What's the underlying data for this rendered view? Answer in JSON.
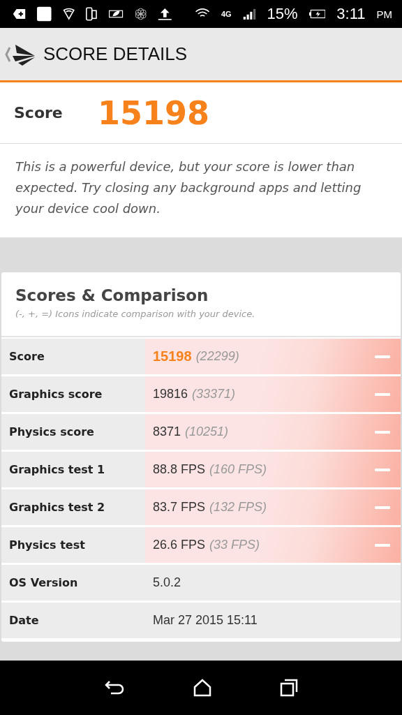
{
  "status_bar": {
    "battery_percent": "15%",
    "time": "3:11",
    "time_suffix": "PM",
    "network_label": "4G"
  },
  "header": {
    "title": "SCORE DETAILS"
  },
  "score": {
    "label": "Score",
    "value": "15198"
  },
  "message": "This is a powerful device, but your score is lower than expected. Try closing any background apps and letting your device cool down.",
  "comparison": {
    "title": "Scores & Comparison",
    "subtitle": "(-, +, =) Icons indicate comparison with your device.",
    "rows": [
      {
        "kind": "score",
        "label": "Score",
        "value": "15198",
        "reference": "(22299)",
        "lower": true
      },
      {
        "kind": "compare",
        "label": "Graphics score",
        "value": "19816",
        "reference": "(33371)",
        "lower": true
      },
      {
        "kind": "compare",
        "label": "Physics score",
        "value": "8371",
        "reference": "(10251)",
        "lower": true
      },
      {
        "kind": "compare",
        "label": "Graphics test 1",
        "value": "88.8 FPS",
        "reference": "(160 FPS)",
        "lower": true
      },
      {
        "kind": "compare",
        "label": "Graphics test 2",
        "value": "83.7 FPS",
        "reference": "(132 FPS)",
        "lower": true
      },
      {
        "kind": "compare",
        "label": "Physics test",
        "value": "26.6 FPS",
        "reference": "(33 FPS)",
        "lower": true
      },
      {
        "kind": "info",
        "label": "OS Version",
        "value": "5.0.2"
      },
      {
        "kind": "info",
        "label": "Date",
        "value": "Mar 27 2015 15:11"
      }
    ]
  }
}
